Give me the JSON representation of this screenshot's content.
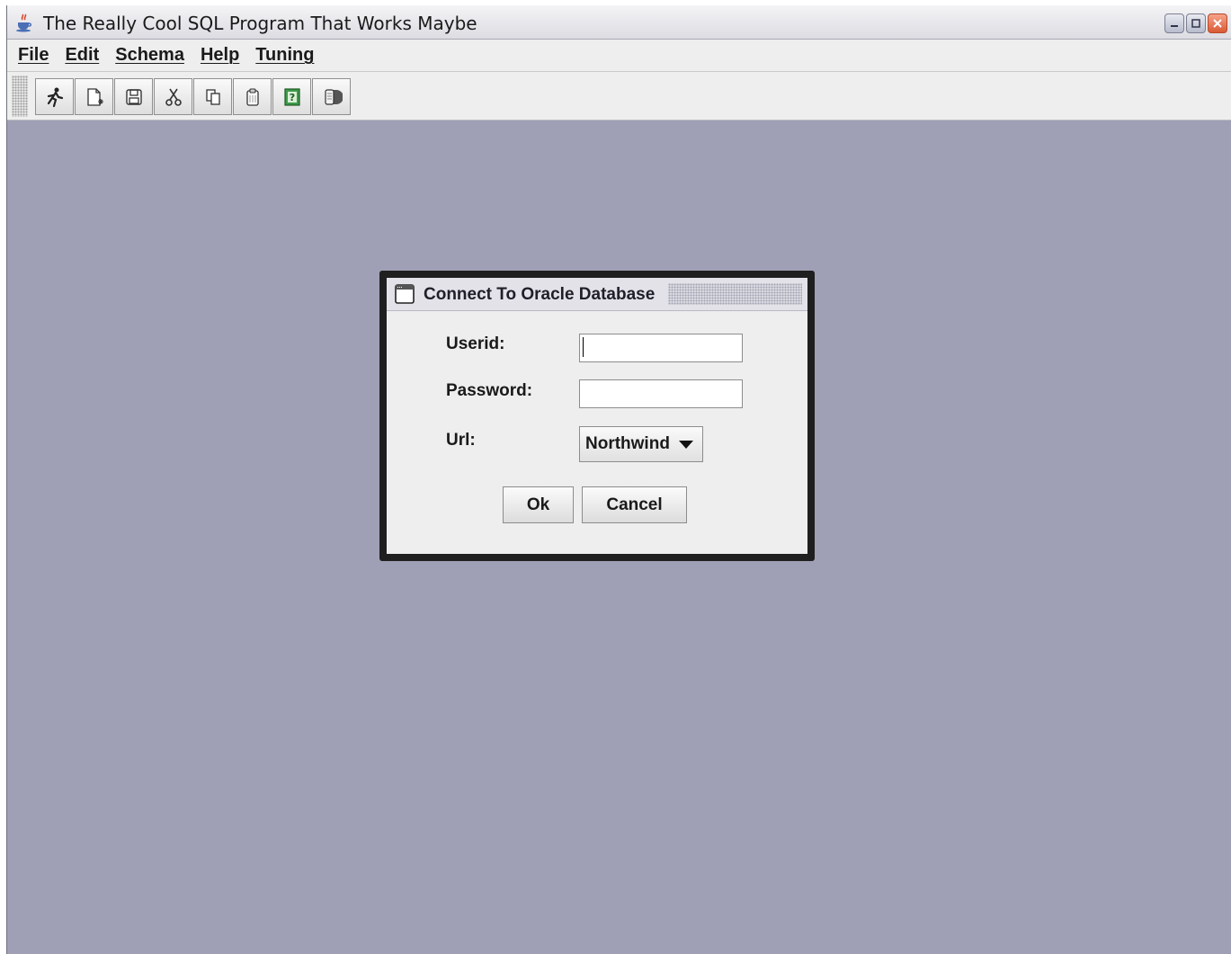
{
  "window": {
    "title": "The Really Cool SQL Program That Works Maybe",
    "app_icon": "java-cup-icon",
    "controls": [
      "minimize-icon",
      "maximize-icon",
      "close-icon"
    ]
  },
  "menubar": {
    "items": [
      {
        "label": "File"
      },
      {
        "label": "Edit"
      },
      {
        "label": "Schema"
      },
      {
        "label": "Help"
      },
      {
        "label": "Tuning"
      }
    ]
  },
  "toolbar": {
    "buttons": [
      {
        "icon": "run-icon"
      },
      {
        "icon": "new-document-icon"
      },
      {
        "icon": "save-icon"
      },
      {
        "icon": "cut-icon"
      },
      {
        "icon": "copy-icon"
      },
      {
        "icon": "paste-icon"
      },
      {
        "icon": "help-icon"
      },
      {
        "icon": "database-icon"
      }
    ]
  },
  "dialog": {
    "title": "Connect To Oracle Database",
    "fields": {
      "userid_label": "Userid:",
      "userid_value": "",
      "password_label": "Password:",
      "password_value": "",
      "url_label": "Url:",
      "url_value": "Northwind"
    },
    "ok_label": "Ok",
    "cancel_label": "Cancel"
  },
  "colors": {
    "desktop": "#9fa0b6",
    "chrome": "#eeeeee",
    "dialog_border": "#1f1f1f"
  }
}
